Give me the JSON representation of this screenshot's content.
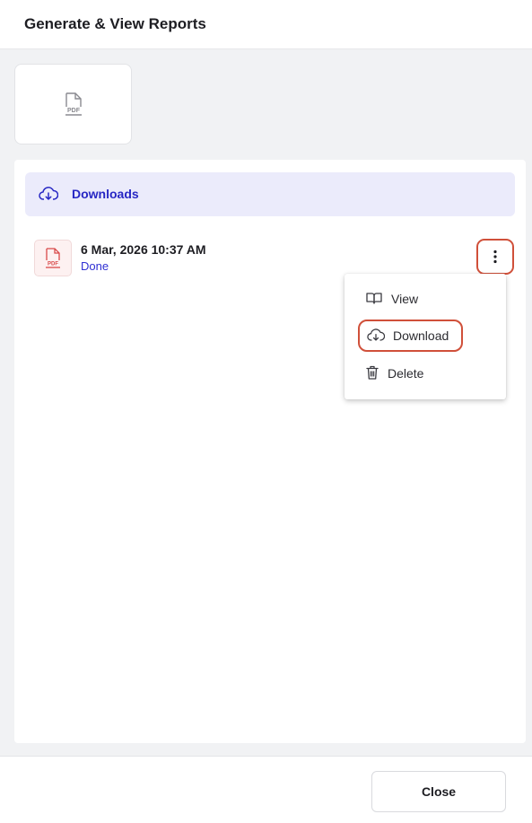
{
  "header": {
    "title": "Generate & View Reports"
  },
  "format_card": {
    "icon": "pdf-file-icon",
    "label": "PDF"
  },
  "downloads": {
    "label": "Downloads",
    "icon": "cloud-download-icon",
    "accent": "#2727c4"
  },
  "report": {
    "icon": "pdf-file-icon",
    "icon_label": "PDF",
    "date": "6 Mar, 2026 10:37 AM",
    "status": "Done"
  },
  "menu": {
    "view": "View",
    "download": "Download",
    "delete": "Delete"
  },
  "footer": {
    "close_label": "Close"
  },
  "colors": {
    "highlight": "#d0503a",
    "pdf_red": "#d94a4a",
    "link_blue": "#2f2fd3"
  }
}
